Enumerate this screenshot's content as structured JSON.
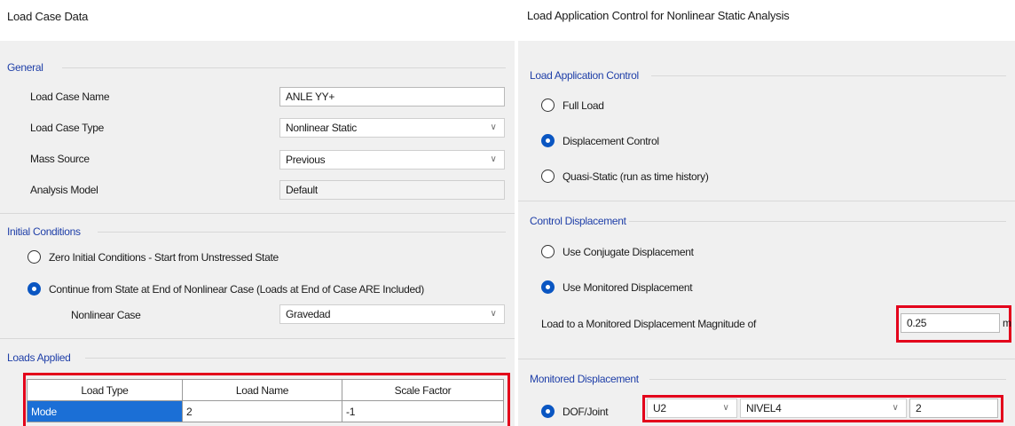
{
  "load_case": {
    "title": "Load Case Data",
    "general": {
      "section_title": "General",
      "case_name_label": "Load Case Name",
      "case_name_value": "ANLE YY+",
      "case_type_label": "Load Case Type",
      "case_type_value": "Nonlinear Static",
      "mass_source_label": "Mass Source",
      "mass_source_value": "Previous",
      "analysis_model_label": "Analysis Model",
      "analysis_model_value": "Default"
    },
    "initial_conditions": {
      "section_title": "Initial Conditions",
      "option_zero": "Zero Initial Conditions - Start from Unstressed State",
      "option_continue": "Continue from State at End of Nonlinear Case  (Loads at End of Case ARE Included)",
      "selected": "continue",
      "nonlinear_case_label": "Nonlinear Case",
      "nonlinear_case_value": "Gravedad"
    },
    "loads_applied": {
      "section_title": "Loads Applied",
      "columns": [
        "Load Type",
        "Load Name",
        "Scale Factor"
      ],
      "rows": [
        [
          "Mode",
          "2",
          "-1"
        ]
      ]
    }
  },
  "load_application": {
    "title": "Load Application Control for Nonlinear Static Analysis",
    "control": {
      "section_title": "Load Application Control",
      "option_full": "Full Load",
      "option_displacement": "Displacement Control",
      "option_quasi": "Quasi-Static (run as time history)",
      "selected": "displacement"
    },
    "control_displacement": {
      "section_title": "Control Displacement",
      "option_conjugate": "Use Conjugate Displacement",
      "option_monitored": "Use Monitored Displacement",
      "selected": "monitored",
      "magnitude_label": "Load to a Monitored Displacement Magnitude of",
      "magnitude_value": "0.25",
      "magnitude_unit": "m"
    },
    "monitored_displacement": {
      "section_title": "Monitored Displacement",
      "option_dof": "DOF/Joint",
      "dof_value": "U2",
      "joint_value": "NIVEL4",
      "point_value": "2"
    }
  },
  "colors": {
    "accent_red": "#e3001b",
    "section_blue": "#1f3fa8",
    "selection_blue": "#1b6fd6",
    "radio_blue": "#0a56c2"
  },
  "icons": [
    "radio-selected-icon",
    "radio-unselected-icon",
    "chevron-down-icon"
  ]
}
